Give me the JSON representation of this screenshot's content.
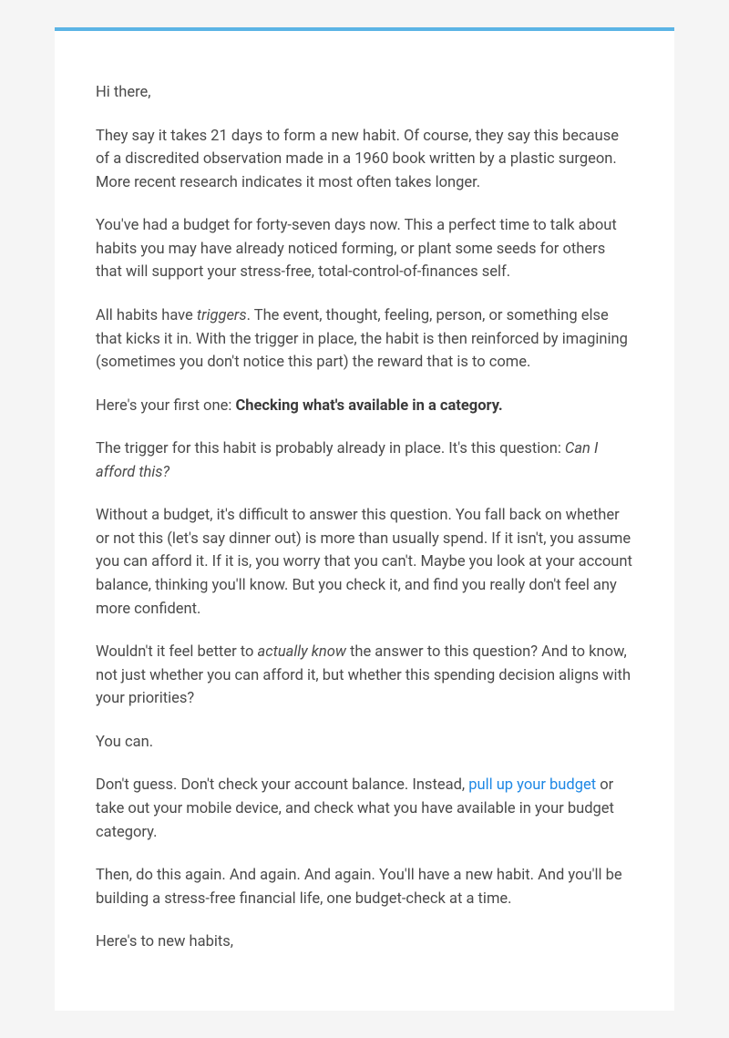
{
  "email": {
    "greeting": "Hi there,",
    "p1": "They say it takes 21 days to form a new habit. Of course, they say this because of a discredited observation made in a 1960 book written by a plastic surgeon. More recent research indicates it most often takes longer.",
    "p2": "You've had a budget for forty-seven days now. This a perfect time to talk about habits you may have already noticed forming, or plant some seeds for others that will support your stress-free, total-control-of-finances self.",
    "p3_pre": "All habits have ",
    "p3_em": "triggers",
    "p3_post": ". The event, thought, feeling, person, or something else that kicks it in. With the trigger in place, the habit is then reinforced by imagining (sometimes you don't notice this part) the reward that is to come.",
    "p4_pre": "Here's your first one: ",
    "p4_strong": "Checking what's available in a category.",
    "p5_pre": "The trigger for this habit is probably already in place. It's this question: ",
    "p5_em": "Can I afford this?",
    "p6": "Without a budget, it's difficult to answer this question. You fall back on whether or not this (let's say dinner out) is more than usually spend. If it isn't, you assume you can afford it. If it is, you worry that you can't. Maybe you look at your account balance, thinking you'll know. But you check it, and find you really don't feel any more confident.",
    "p7_pre": "Wouldn't it feel better to ",
    "p7_em": "actually know",
    "p7_post": " the answer to this question? And to know, not just whether you can afford it, but whether this spending decision aligns with your priorities?",
    "p8": "You can.",
    "p9_pre": "Don't guess. Don't check your account balance. Instead, ",
    "p9_link": "pull up your budget",
    "p9_post": " or take out your mobile device, and check what you have available in your budget category.",
    "p10": "Then, do this again. And again. And again. You'll have a new habit. And you'll be building a stress-free financial life, one budget-check at a time.",
    "p11": "Here's to new habits,"
  }
}
